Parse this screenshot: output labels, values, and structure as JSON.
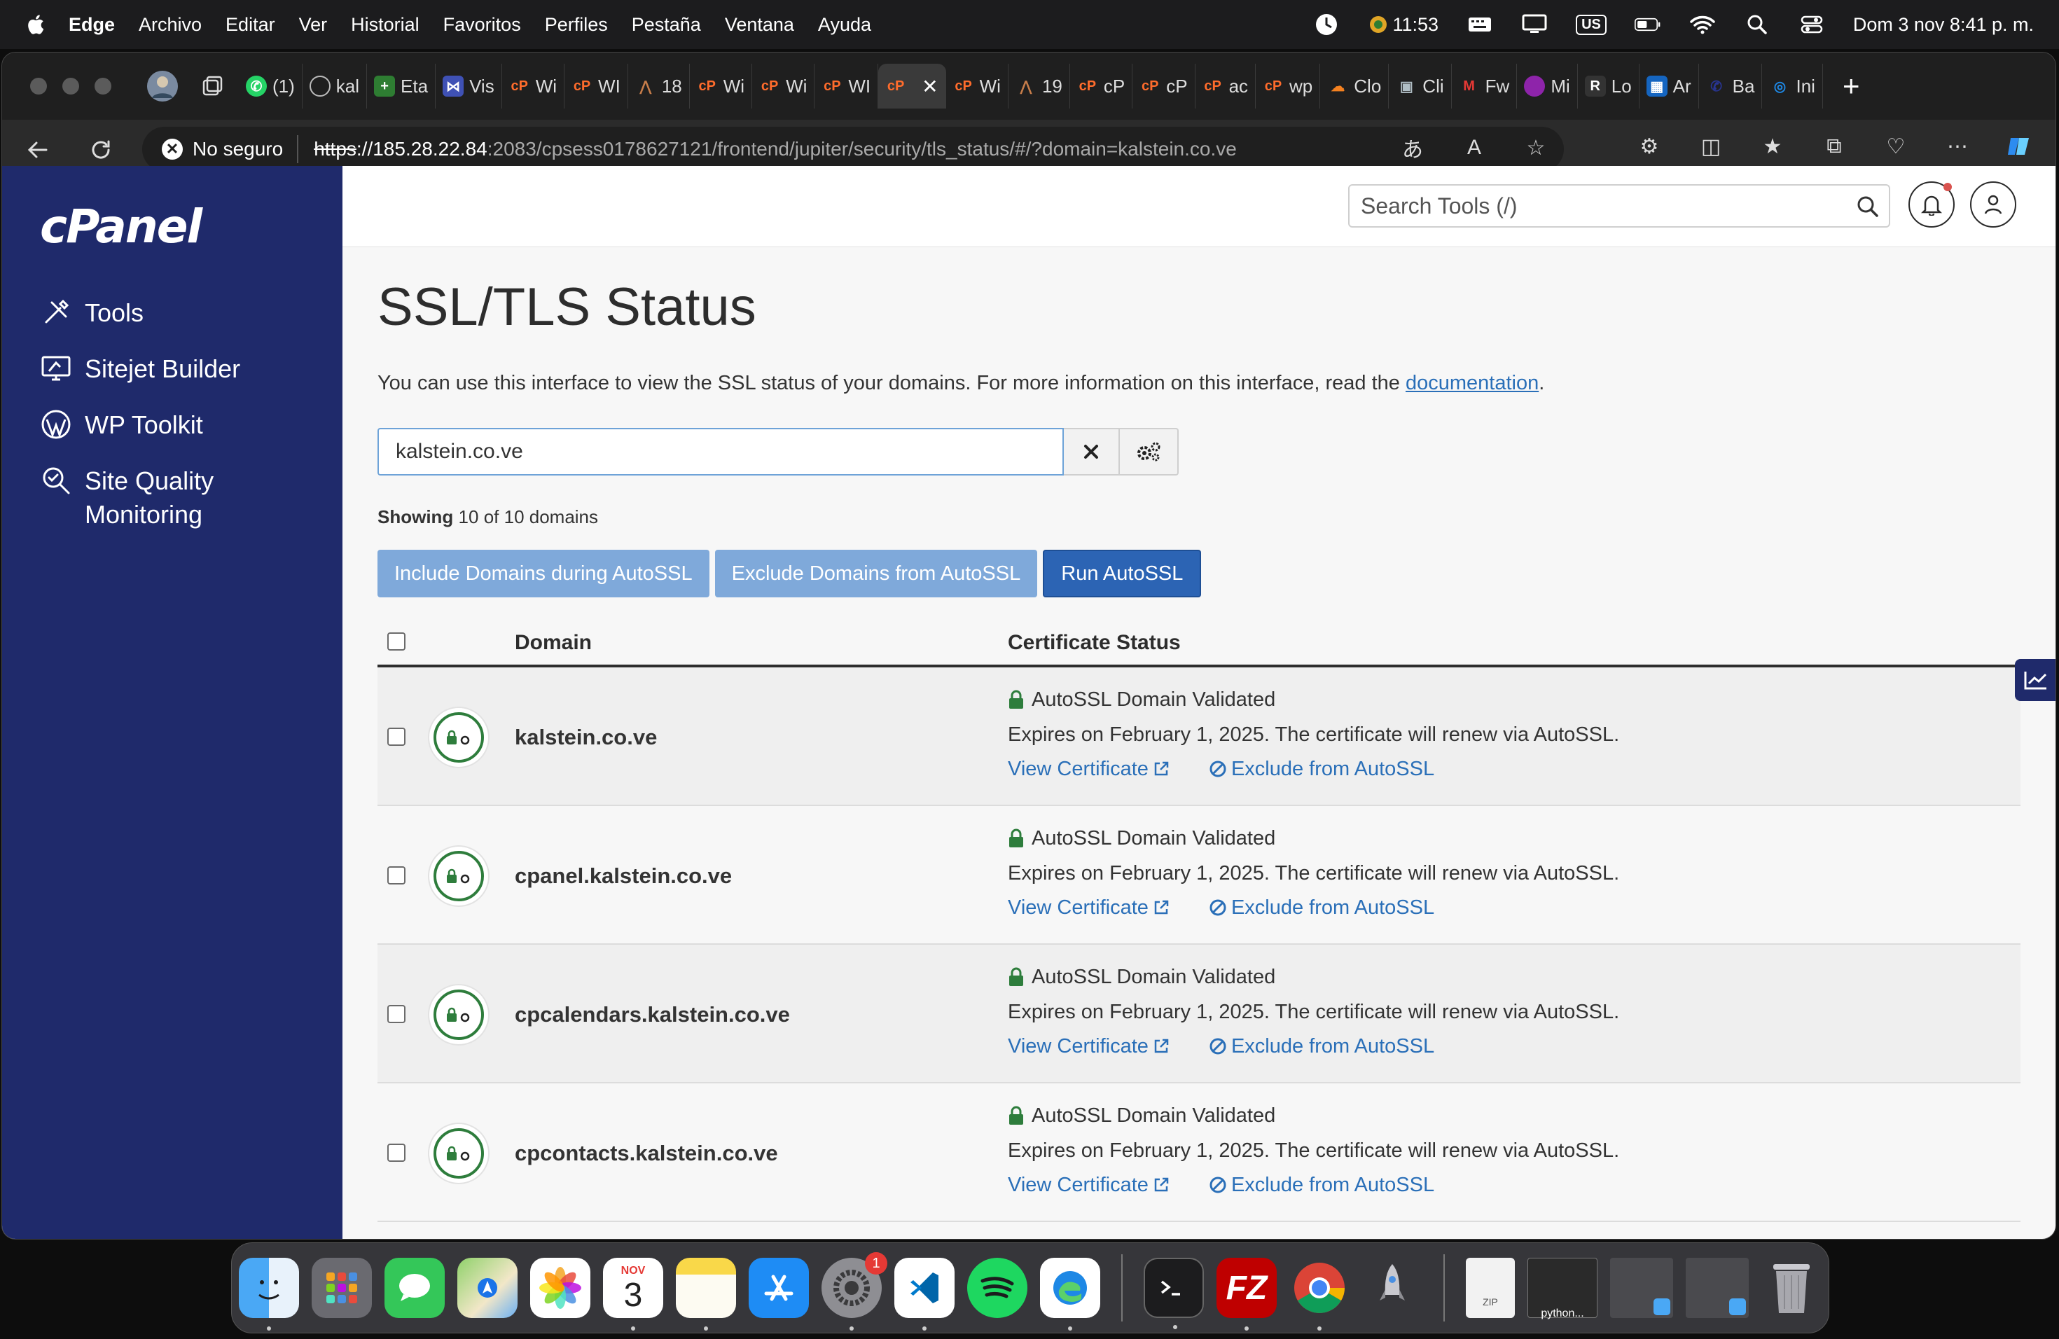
{
  "menubar": {
    "app": "Edge",
    "items": [
      "Archivo",
      "Editar",
      "Ver",
      "Historial",
      "Favoritos",
      "Perfiles",
      "Pestaña",
      "Ventana",
      "Ayuda"
    ],
    "status_time": "11:53",
    "keyboard": "US",
    "datetime": "Dom 3 nov 8:41 p. m."
  },
  "tabs": [
    {
      "label": "kal",
      "color": "#6b7a8f"
    },
    {
      "label": "Eta",
      "color": "#2e7d32"
    },
    {
      "label": "Vis",
      "color": "#3f51b5"
    },
    {
      "label": "Wi",
      "color": "#ff6c2c"
    },
    {
      "label": "WI",
      "color": "#ff6c2c"
    },
    {
      "label": "18",
      "color": "#a0522d"
    },
    {
      "label": "Wi",
      "color": "#ff6c2c"
    },
    {
      "label": "Wi",
      "color": "#ff6c2c"
    },
    {
      "label": "WI",
      "color": "#ff6c2c"
    },
    {
      "label": "",
      "color": "#ff6c2c",
      "active": true
    },
    {
      "label": "Wi",
      "color": "#ff6c2c"
    },
    {
      "label": "19",
      "color": "#a0522d"
    },
    {
      "label": "cP",
      "color": "#ff6c2c"
    },
    {
      "label": "cP",
      "color": "#ff6c2c"
    },
    {
      "label": "ac",
      "color": "#ff6c2c"
    },
    {
      "label": "wp",
      "color": "#ff6c2c"
    },
    {
      "label": "Clo",
      "color": "#f48120"
    },
    {
      "label": "Cli",
      "color": "#607d8b"
    },
    {
      "label": "Fw",
      "color": "#c62828"
    },
    {
      "label": "Mi",
      "color": "#8e24aa"
    },
    {
      "label": "Lo",
      "color": "#333333"
    },
    {
      "label": "Ar",
      "color": "#1565c0"
    },
    {
      "label": "Ba",
      "color": "#1a237e"
    },
    {
      "label": "Ini",
      "color": "#1565c0"
    }
  ],
  "tab_prefix": {
    "whatsapp_count": "(1)"
  },
  "address": {
    "security": "No seguro",
    "scheme": "https",
    "host": "://185.28.22.84",
    "path": ":2083/cpsess0178627121/frontend/jupiter/security/tls_status/#/?domain=kalstein.co.ve"
  },
  "sidebar": {
    "logo": "cPanel",
    "items": [
      {
        "label": "Tools",
        "icon": "tools-icon"
      },
      {
        "label": "Sitejet Builder",
        "icon": "monitor-icon"
      },
      {
        "label": "WP Toolkit",
        "icon": "wordpress-icon"
      },
      {
        "label": "Site Quality",
        "label2": "Monitoring",
        "icon": "magnifier-icon"
      }
    ]
  },
  "header": {
    "search_placeholder": "Search Tools (/)"
  },
  "page": {
    "title": "SSL/TLS Status",
    "intro": "You can use this interface to view the SSL status of your domains. For more information on this interface, read the ",
    "intro_link": "documentation",
    "intro_end": ".",
    "filter_value": "kalstein.co.ve",
    "showing_label": "Showing",
    "showing_text": " 10 of 10 domains",
    "buttons": {
      "include": "Include Domains during AutoSSL",
      "exclude": "Exclude Domains from AutoSSL",
      "run": "Run AutoSSL"
    },
    "columns": {
      "domain": "Domain",
      "status": "Certificate Status"
    },
    "rows": [
      {
        "domain": "kalstein.co.ve",
        "status": "AutoSSL Domain Validated",
        "expires": "Expires on February 1, 2025. The certificate will renew via AutoSSL.",
        "view": "View Certificate",
        "exclude": "Exclude from AutoSSL"
      },
      {
        "domain": "cpanel.kalstein.co.ve",
        "status": "AutoSSL Domain Validated",
        "expires": "Expires on February 1, 2025. The certificate will renew via AutoSSL.",
        "view": "View Certificate",
        "exclude": "Exclude from AutoSSL"
      },
      {
        "domain": "cpcalendars.kalstein.co.ve",
        "status": "AutoSSL Domain Validated",
        "expires": "Expires on February 1, 2025. The certificate will renew via AutoSSL.",
        "view": "View Certificate",
        "exclude": "Exclude from AutoSSL"
      },
      {
        "domain": "cpcontacts.kalstein.co.ve",
        "status": "AutoSSL Domain Validated",
        "expires": "Expires on February 1, 2025. The certificate will renew via AutoSSL.",
        "view": "View Certificate",
        "exclude": "Exclude from AutoSSL"
      }
    ]
  },
  "dock": {
    "calendar_month": "NOV",
    "calendar_day": "3",
    "settings_badge": "1",
    "python_label": "python...",
    "zip_label": "ZIP",
    "filezilla": "FZ"
  },
  "colors": {
    "sidebar": "#1f2a6b",
    "link": "#2a6fb8",
    "primary_button": "#2c64b4",
    "light_button": "#7fa9da",
    "validated_green": "#2e7d3c"
  }
}
